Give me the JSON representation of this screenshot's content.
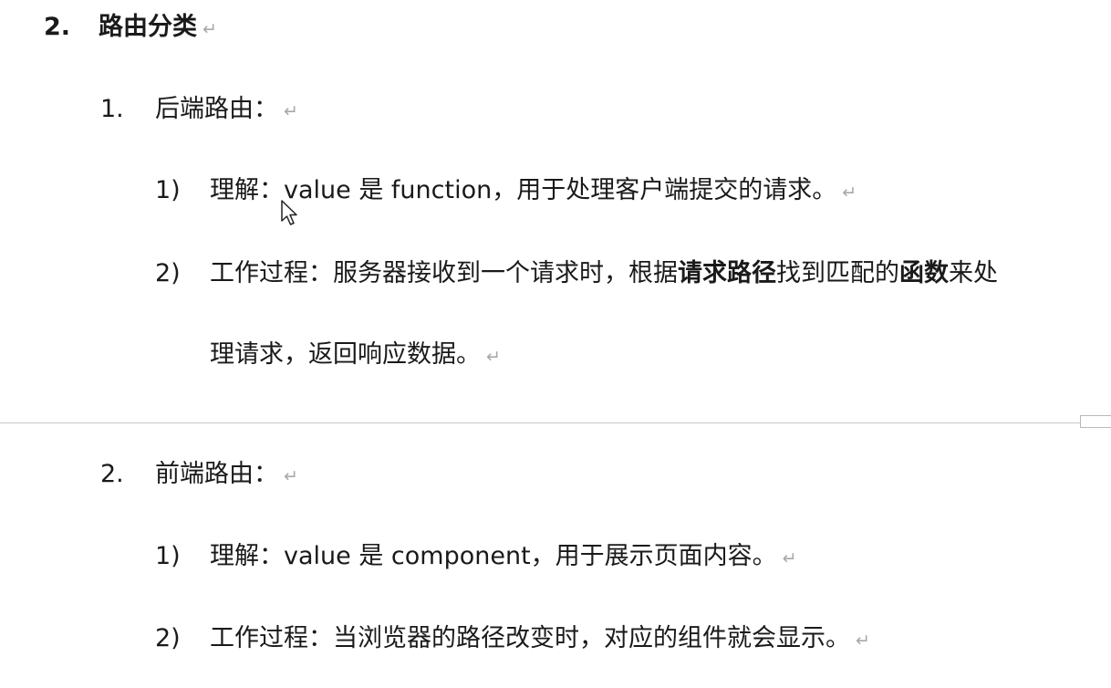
{
  "heading": {
    "number": "2.",
    "title": "路由分类"
  },
  "sections": [
    {
      "number": "1.",
      "title": "后端路由：",
      "items": [
        {
          "number": "1)",
          "line1": "理解：value 是 function，用于处理客户端提交的请求。"
        },
        {
          "number": "2)",
          "line1_a": "工作过程：服务器接收到一个请求时，根据",
          "line1_b": "请求路径",
          "line1_c": "找到匹配的",
          "line1_d": "函数",
          "line1_e": "来处",
          "line2": "理请求，返回响应数据。"
        }
      ]
    },
    {
      "number": "2.",
      "title": "前端路由：",
      "items": [
        {
          "number": "1)",
          "line1": "理解：value 是 component，用于展示页面内容。"
        },
        {
          "number": "2)",
          "line1": "工作过程：当浏览器的路径改变时，对应的组件就会显示。"
        }
      ]
    }
  ],
  "paragraph_mark": "↵"
}
